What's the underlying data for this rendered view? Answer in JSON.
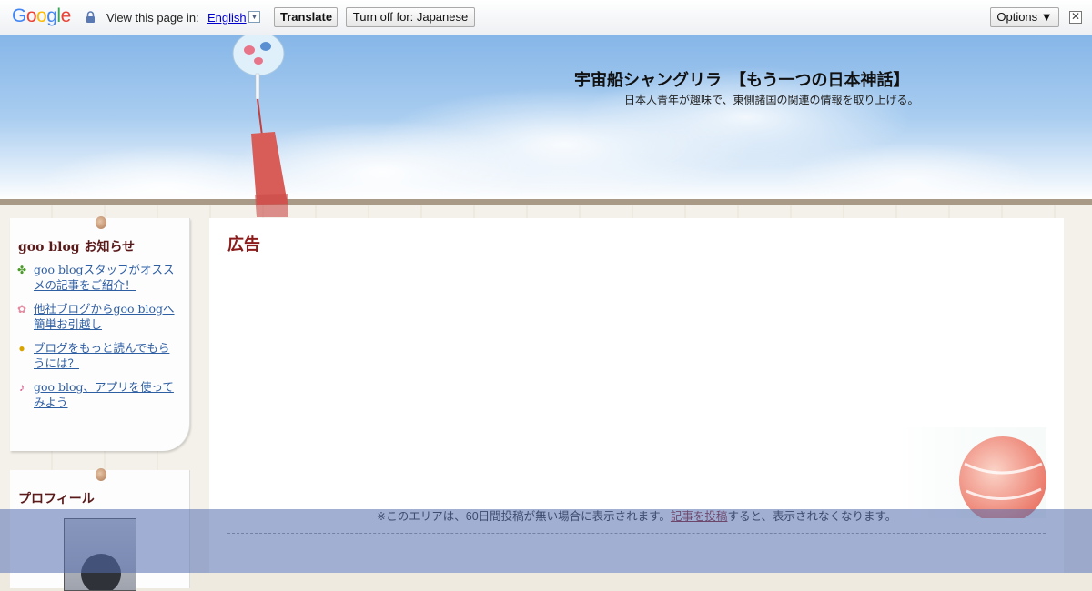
{
  "translate_bar": {
    "logo": "Google",
    "view_label": "View this page in:",
    "language": "English",
    "translate_button": "Translate",
    "turn_off_button": "Turn off for: Japanese",
    "options_button": "Options ▼",
    "close": "✕",
    "colors": {
      "blue": "#4285f4",
      "red": "#ea4335",
      "yellow": "#fbbc05",
      "green": "#34a853"
    }
  },
  "header": {
    "site_title": "宇宙船シャングリラ　【もう一つの日本神話】",
    "site_description": "日本人青年が趣味で、東側諸国の関連の情報を取り上げる。"
  },
  "sidebar": {
    "notice_box": {
      "title": "goo blog お知らせ",
      "items": [
        {
          "icon": "clover-icon",
          "label": "goo blogスタッフがオススメの記事をご紹介！"
        },
        {
          "icon": "flower-icon",
          "label": "他社ブログからgoo blogへ簡単お引越し"
        },
        {
          "icon": "bulb-icon",
          "label": "ブログをもっと読んでもらうには？"
        },
        {
          "icon": "music-note-icon",
          "label": "goo blog、アプリを使ってみよう"
        }
      ]
    },
    "profile_box": {
      "title": "プロフィール"
    }
  },
  "main": {
    "ad_title": "広告",
    "notice_prefix": "※このエリアは、60日間投稿が無い場合に表示されます。",
    "notice_link": "記事を投稿",
    "notice_suffix": "すると、表示されなくなります。"
  }
}
